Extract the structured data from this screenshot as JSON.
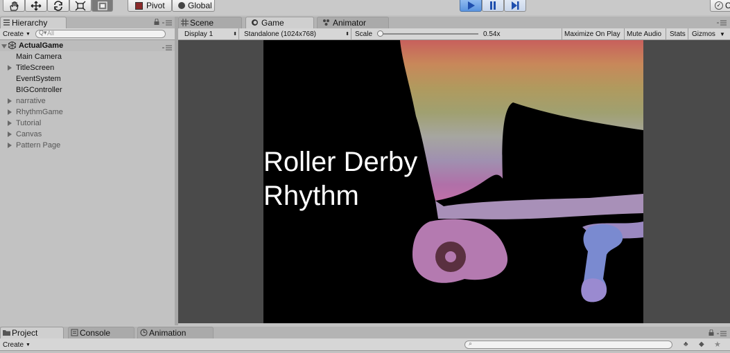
{
  "toolbar": {
    "pivot_label": "Pivot",
    "global_label": "Global",
    "right_label": "C"
  },
  "hierarchy": {
    "tab_label": "Hierarchy",
    "create_label": "Create",
    "search_placeholder": "All",
    "scene_name": "ActualGame",
    "items": [
      {
        "label": "Main Camera",
        "expandable": false,
        "active": true
      },
      {
        "label": "TitleScreen",
        "expandable": true,
        "active": true
      },
      {
        "label": "EventSystem",
        "expandable": false,
        "active": true
      },
      {
        "label": "BIGController",
        "expandable": false,
        "active": true
      },
      {
        "label": "narrative",
        "expandable": true,
        "active": false
      },
      {
        "label": "RhythmGame",
        "expandable": true,
        "active": false
      },
      {
        "label": "Tutorial",
        "expandable": true,
        "active": false
      },
      {
        "label": "Canvas",
        "expandable": true,
        "active": false
      },
      {
        "label": "Pattern Page",
        "expandable": true,
        "active": false
      }
    ]
  },
  "game_view": {
    "tabs": {
      "scene": "Scene",
      "game": "Game",
      "animator": "Animator"
    },
    "display": "Display 1",
    "resolution": "Standalone (1024x768)",
    "scale_label": "Scale",
    "scale_value": "0.54x",
    "scale_fraction": 0.0,
    "maximize_label": "Maximize On Play",
    "mute_label": "Mute Audio",
    "stats_label": "Stats",
    "gizmos_label": "Gizmos",
    "title_line1": "Roller Derby",
    "title_line2": "Rhythm"
  },
  "bottom": {
    "tabs": {
      "project": "Project",
      "console": "Console",
      "animation": "Animation"
    },
    "create_label": "Create"
  },
  "colors": {
    "play_active": "#5a94e0",
    "game_background": "#000000",
    "letterbox": "#4a4a4a"
  }
}
